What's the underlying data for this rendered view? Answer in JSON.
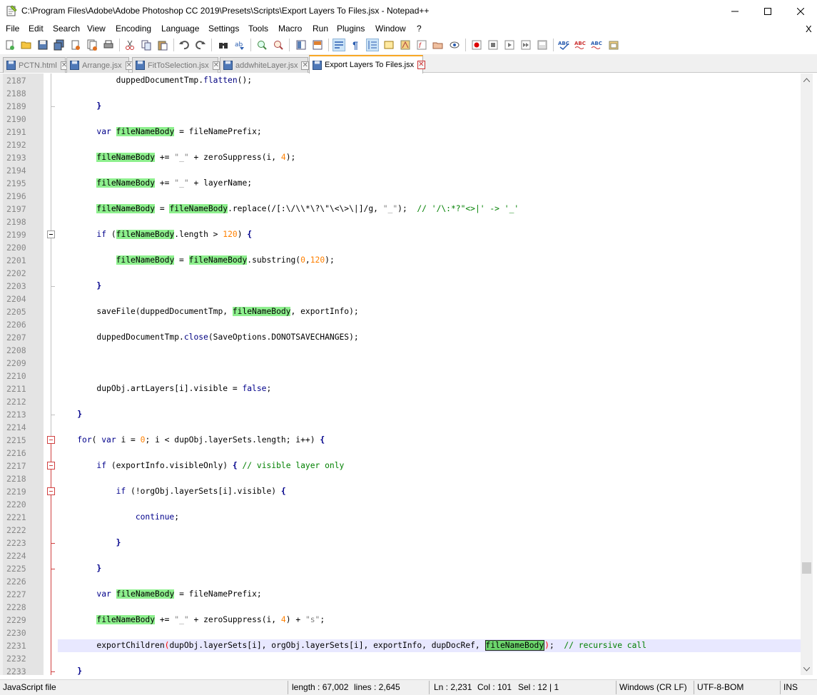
{
  "window": {
    "title": "C:\\Program Files\\Adobe\\Adobe Photoshop CC 2019\\Presets\\Scripts\\Export Layers To Files.jsx - Notepad++"
  },
  "menu": [
    "File",
    "Edit",
    "Search",
    "View",
    "Encoding",
    "Language",
    "Settings",
    "Tools",
    "Macro",
    "Run",
    "Plugins",
    "Window",
    "?"
  ],
  "menu_close": "X",
  "toolbar": {
    "icons": [
      "new-file-icon",
      "open-file-icon",
      "save-icon",
      "save-all-icon",
      "close-icon",
      "close-all-icon",
      "print-icon",
      "cut-icon",
      "copy-icon",
      "paste-icon",
      "undo-icon",
      "redo-icon",
      "find-icon",
      "replace-icon",
      "zoom-in-icon",
      "zoom-out-icon",
      "sync-vertical-icon",
      "sync-horizontal-icon",
      "word-wrap-icon",
      "show-all-chars-icon",
      "indent-guide-icon",
      "user-language-icon",
      "doc-map-icon",
      "function-list-icon",
      "folder-workspace-icon",
      "monitoring-icon",
      "record-macro-icon",
      "stop-record-icon",
      "play-macro-icon",
      "run-macro-multiple-icon",
      "save-macro-icon",
      "spellcheck-icon",
      "spellcheck-next-icon",
      "spellcheck-prev-icon",
      "clipboard-history-icon"
    ]
  },
  "tabs": [
    {
      "label": "PCTN.html",
      "active": false
    },
    {
      "label": "Arrange.jsx",
      "active": false
    },
    {
      "label": "FitToSelection.jsx",
      "active": false
    },
    {
      "label": "addwhiteLayer.jsx",
      "active": false
    },
    {
      "label": "Export Layers To Files.jsx",
      "active": true
    }
  ],
  "editor": {
    "current_line": "2231",
    "lines": [
      {
        "n": "2187",
        "html": "            duppedDocumentTmp.<span class=\"op\">flatten</span>();"
      },
      {
        "n": "2188",
        "html": ""
      },
      {
        "n": "2189",
        "html": "        <span class=\"brace\">}</span>"
      },
      {
        "n": "2190",
        "html": ""
      },
      {
        "n": "2191",
        "html": "        <span class=\"kw\">var</span> <span class=\"hl\">fileNameBody</span> = fileNamePrefix;"
      },
      {
        "n": "2192",
        "html": ""
      },
      {
        "n": "2193",
        "html": "        <span class=\"hl\">fileNameBody</span> += <span class=\"str\">\"_\"</span> + zeroSuppress(i, <span class=\"num\">4</span>);"
      },
      {
        "n": "2194",
        "html": ""
      },
      {
        "n": "2195",
        "html": "        <span class=\"hl\">fileNameBody</span> += <span class=\"str\">\"_\"</span> + layerName;"
      },
      {
        "n": "2196",
        "html": ""
      },
      {
        "n": "2197",
        "html": "        <span class=\"hl\">fileNameBody</span> = <span class=\"hl\">fileNameBody</span>.replace(/[:\\/\\\\*\\?\\\"\\&lt;\\&gt;\\|]/g, <span class=\"str\">\"_\"</span>);  <span class=\"cm\">// '/\\:*?\"&lt;&gt;|' -&gt; '_'</span>"
      },
      {
        "n": "2198",
        "html": ""
      },
      {
        "n": "2199",
        "html": "        <span class=\"kw\">if</span> (<span class=\"hl\">fileNameBody</span>.length &gt; <span class=\"num\">120</span>) <span class=\"brace\">{</span>"
      },
      {
        "n": "2200",
        "html": ""
      },
      {
        "n": "2201",
        "html": "            <span class=\"hl\">fileNameBody</span> = <span class=\"hl\">fileNameBody</span>.substring(<span class=\"num\">0</span>,<span class=\"num\">120</span>);"
      },
      {
        "n": "2202",
        "html": ""
      },
      {
        "n": "2203",
        "html": "        <span class=\"brace\">}</span>"
      },
      {
        "n": "2204",
        "html": ""
      },
      {
        "n": "2205",
        "html": "        saveFile(duppedDocumentTmp, <span class=\"hl\">fileNameBody</span>, exportInfo);"
      },
      {
        "n": "2206",
        "html": ""
      },
      {
        "n": "2207",
        "html": "        duppedDocumentTmp.<span class=\"op\">close</span>(SaveOptions.DONOTSAVECHANGES);"
      },
      {
        "n": "2208",
        "html": ""
      },
      {
        "n": "2209",
        "html": ""
      },
      {
        "n": "2210",
        "html": ""
      },
      {
        "n": "2211",
        "html": "        dupObj.artLayers[i].visible = <span class=\"kw\">false</span>;"
      },
      {
        "n": "2212",
        "html": ""
      },
      {
        "n": "2213",
        "html": "    <span class=\"brace\">}</span>"
      },
      {
        "n": "2214",
        "html": ""
      },
      {
        "n": "2215",
        "html": "    <span class=\"kw\">for</span>( <span class=\"kw\">var</span> i = <span class=\"num\">0</span>; i &lt; dupObj.layerSets.length; i++) <span class=\"brace\">{</span>"
      },
      {
        "n": "2216",
        "html": ""
      },
      {
        "n": "2217",
        "html": "        <span class=\"kw\">if</span> (exportInfo.visibleOnly) <span class=\"brace\">{</span> <span class=\"cm\">// visible layer only</span>"
      },
      {
        "n": "2218",
        "html": ""
      },
      {
        "n": "2219",
        "html": "            <span class=\"kw\">if</span> (!orgObj.layerSets[i].visible) <span class=\"brace\">{</span>"
      },
      {
        "n": "2220",
        "html": ""
      },
      {
        "n": "2221",
        "html": "                <span class=\"kw\">continue</span>;"
      },
      {
        "n": "2222",
        "html": ""
      },
      {
        "n": "2223",
        "html": "            <span class=\"brace\">}</span>"
      },
      {
        "n": "2224",
        "html": ""
      },
      {
        "n": "2225",
        "html": "        <span class=\"brace\">}</span>"
      },
      {
        "n": "2226",
        "html": ""
      },
      {
        "n": "2227",
        "html": "        <span class=\"kw\">var</span> <span class=\"hl\">fileNameBody</span> = fileNamePrefix;"
      },
      {
        "n": "2228",
        "html": ""
      },
      {
        "n": "2229",
        "html": "        <span class=\"hl\">fileNameBody</span> += <span class=\"str\">\"_\"</span> + zeroSuppress(i, <span class=\"num\">4</span>) + <span class=\"str\">\"s\"</span>;"
      },
      {
        "n": "2230",
        "html": ""
      },
      {
        "n": "2231",
        "html": "        exportChildren<span class=\"bm\">(</span>dupObj.layerSets[i], orgObj.layerSets[i], exportInfo, dupDocRef, <span class=\"hl2\">fileNameBody</span><span class=\"bm\">)</span>;  <span class=\"cm\">// recursive call</span>"
      },
      {
        "n": "2232",
        "html": ""
      },
      {
        "n": "2233",
        "html": "    <span class=\"brace\">}</span>"
      }
    ]
  },
  "status": {
    "language": "JavaScript file",
    "length": "length : 67,002",
    "lines": "lines : 2,645",
    "ln": "Ln : 2,231",
    "col": "Col : 101",
    "sel": "Sel : 12 | 1",
    "eol": "Windows (CR LF)",
    "encoding": "UTF-8-BOM",
    "mode": "INS"
  }
}
